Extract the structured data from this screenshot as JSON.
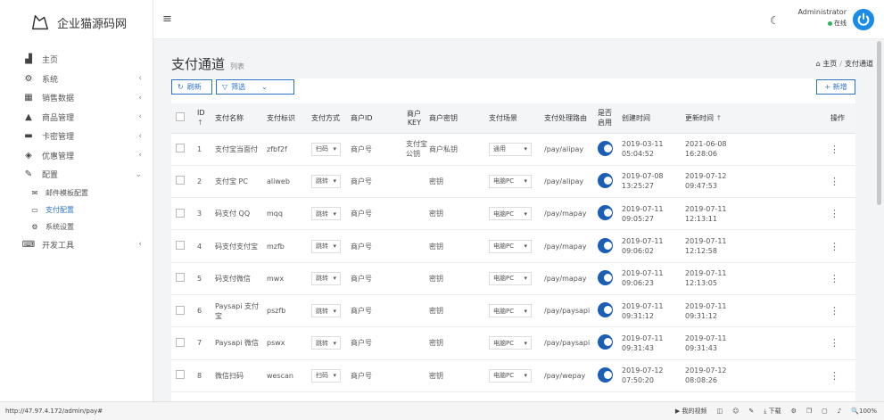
{
  "app": {
    "logo_text": "企业猫源码网"
  },
  "sidebar": {
    "items": [
      {
        "icon": "bar-chart-icon",
        "label": "主页",
        "arrow": ""
      },
      {
        "icon": "gear-icon",
        "label": "系统",
        "arrow": "‹"
      },
      {
        "icon": "grid-icon",
        "label": "销售数据",
        "arrow": "‹"
      },
      {
        "icon": "bag-icon",
        "label": "商品管理",
        "arrow": "‹"
      },
      {
        "icon": "card-icon",
        "label": "卡密管理",
        "arrow": "‹"
      },
      {
        "icon": "diamond-icon",
        "label": "优惠管理",
        "arrow": "‹"
      },
      {
        "icon": "wrench-icon",
        "label": "配置",
        "arrow": "⌄"
      }
    ],
    "subitems": [
      {
        "icon": "mail-icon",
        "label": "邮件模板配置"
      },
      {
        "icon": "credit-card-icon",
        "label": "支付配置"
      },
      {
        "icon": "cogs-icon",
        "label": "系统设置"
      }
    ],
    "dev_tools": {
      "icon": "keyboard-icon",
      "label": "开发工具",
      "arrow": "‹"
    }
  },
  "header": {
    "user_name": "Administrator",
    "user_status": "在线"
  },
  "page": {
    "title": "支付通道",
    "subtitle": "列表",
    "breadcrumb_home": "主页",
    "breadcrumb_current": "支付通道"
  },
  "toolbar": {
    "refresh_label": "刷新",
    "filter_label": "筛选",
    "add_label": "+ 新增"
  },
  "table": {
    "headers": [
      "ID",
      "支付名称",
      "支付标识",
      "支付方式",
      "商户ID",
      "商户KEY",
      "商户密钥",
      "支付场景",
      "支付处理路由",
      "是否启用",
      "创建时间",
      "更新时间",
      "操作"
    ],
    "id_sort": "↑",
    "updated_sort": "↑",
    "rows": [
      {
        "id": "1",
        "name": "支付宝当面付",
        "code": "zfbf2f",
        "method": "扫码",
        "merchant_id": "商户号",
        "merchant_key": "支付宝公钥",
        "merchant_secret": "商户私钥",
        "scene": "通用",
        "route": "/pay/alipay",
        "created_date": "2019-03-11",
        "created_time": "05:04:52",
        "updated_date": "2021-06-08",
        "updated_time": "16:28:06"
      },
      {
        "id": "2",
        "name": "支付宝 PC",
        "code": "aliweb",
        "method": "跳转",
        "merchant_id": "商户号",
        "merchant_key": "",
        "merchant_secret": "密钥",
        "scene": "电脑PC",
        "route": "/pay/alipay",
        "created_date": "2019-07-08",
        "created_time": "13:25:27",
        "updated_date": "2019-07-12",
        "updated_time": "09:47:53"
      },
      {
        "id": "3",
        "name": "码支付 QQ",
        "code": "mqq",
        "method": "跳转",
        "merchant_id": "商户号",
        "merchant_key": "",
        "merchant_secret": "密钥",
        "scene": "电脑PC",
        "route": "/pay/mapay",
        "created_date": "2019-07-11",
        "created_time": "09:05:27",
        "updated_date": "2019-07-11",
        "updated_time": "12:13:11"
      },
      {
        "id": "4",
        "name": "码支付支付宝",
        "code": "mzfb",
        "method": "跳转",
        "merchant_id": "商户号",
        "merchant_key": "",
        "merchant_secret": "密钥",
        "scene": "电脑PC",
        "route": "/pay/mapay",
        "created_date": "2019-07-11",
        "created_time": "09:06:02",
        "updated_date": "2019-07-11",
        "updated_time": "12:12:58"
      },
      {
        "id": "5",
        "name": "码支付微信",
        "code": "mwx",
        "method": "跳转",
        "merchant_id": "商户号",
        "merchant_key": "",
        "merchant_secret": "密钥",
        "scene": "电脑PC",
        "route": "/pay/mapay",
        "created_date": "2019-07-11",
        "created_time": "09:06:23",
        "updated_date": "2019-07-11",
        "updated_time": "12:13:05"
      },
      {
        "id": "6",
        "name": "Paysapi 支付宝",
        "code": "pszfb",
        "method": "跳转",
        "merchant_id": "商户号",
        "merchant_key": "",
        "merchant_secret": "密钥",
        "scene": "电脑PC",
        "route": "/pay/paysapi",
        "created_date": "2019-07-11",
        "created_time": "09:31:12",
        "updated_date": "2019-07-11",
        "updated_time": "09:31:12"
      },
      {
        "id": "7",
        "name": "Paysapi 微信",
        "code": "pswx",
        "method": "跳转",
        "merchant_id": "商户号",
        "merchant_key": "",
        "merchant_secret": "密钥",
        "scene": "电脑PC",
        "route": "/pay/paysapi",
        "created_date": "2019-07-11",
        "created_time": "09:31:43",
        "updated_date": "2019-07-11",
        "updated_time": "09:31:43"
      },
      {
        "id": "8",
        "name": "微信扫码",
        "code": "wescan",
        "method": "扫码",
        "merchant_id": "商户号",
        "merchant_key": "",
        "merchant_secret": "密钥",
        "scene": "电脑PC",
        "route": "/pay/wepay",
        "created_date": "2019-07-12",
        "created_time": "07:50:20",
        "updated_date": "2019-07-12",
        "updated_time": "08:08:26"
      }
    ]
  },
  "statusbar": {
    "url": "http://47.97.4.172/admin/pay#",
    "video_label": "我的视频",
    "download_label": "下载",
    "zoom": "100%"
  }
}
